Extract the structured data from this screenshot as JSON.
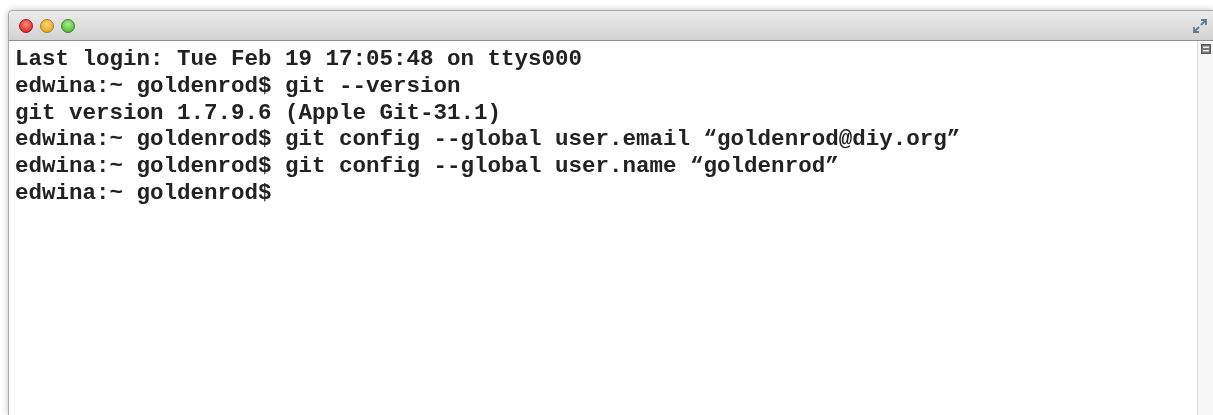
{
  "terminal": {
    "lines": [
      "Last login: Tue Feb 19 17:05:48 on ttys000",
      "edwina:~ goldenrod$ git --version",
      "git version 1.7.9.6 (Apple Git-31.1)",
      "edwina:~ goldenrod$ git config --global user.email “goldenrod@diy.org”",
      "edwina:~ goldenrod$ git config --global user.name “goldenrod”",
      "edwina:~ goldenrod$"
    ]
  }
}
